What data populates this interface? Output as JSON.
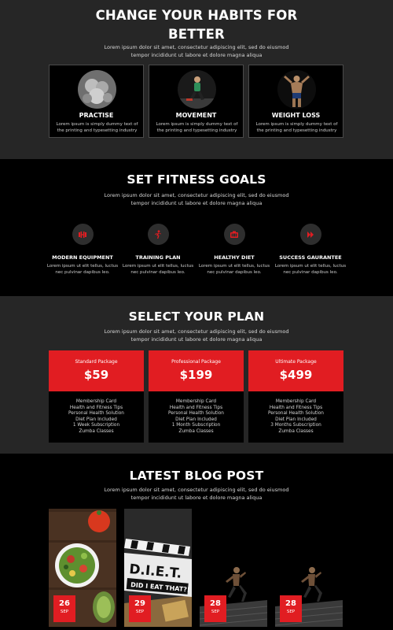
{
  "habits": {
    "title": "CHANGE YOUR HABITS FOR BETTER",
    "subtitle": "Lorem ipsum dolor sit amet, consectetur adipiscing elit, sed do eiusmod tempor incididunt ut labore et dolore magna aliqua",
    "cards": [
      {
        "title": "PRACTISE",
        "text": "Lorem ipsum is simply dummy text of the printing and typesetting industry"
      },
      {
        "title": "MOVEMENT",
        "text": "Lorem ipsum is simply dummy text of the printing and typesetting industry"
      },
      {
        "title": "WEIGHT LOSS",
        "text": "Lorem ipsum is simply dummy text of the printing and typesetting industry"
      }
    ]
  },
  "goals": {
    "title": "SET FITNESS GOALS",
    "subtitle": "Lorem ipsum dolor sit amet, consectetur adipiscing elit, sed do eiusmod tempor incididunt ut labore et dolore magna aliqua",
    "items": [
      {
        "title": "MODERN EQUIPMENT",
        "text": "Lorem ipsum ut elit tellus, luctus nec pulvinar dapibus leo.",
        "icon": "equipment-icon"
      },
      {
        "title": "TRAINING PLAN",
        "text": "Lorem ipsum ut elit tellus, luctus nec pulvinar dapibus leo.",
        "icon": "training-icon"
      },
      {
        "title": "HEALTHY DIET",
        "text": "Lorem ipsum ut elit tellus, luctus nec pulvinar dapibus leo.",
        "icon": "diet-icon"
      },
      {
        "title": "SUCCESS GAURANTEE",
        "text": "Lorem ipsum ut elit tellus, luctus nec pulvinar dapibus leo.",
        "icon": "success-icon"
      }
    ]
  },
  "plans": {
    "title": "SELECT YOUR PLAN",
    "subtitle": "Lorem ipsum dolor sit amet, consectetur adipiscing elit, sed do eiusmod tempor incididunt ut labore et dolore magna aliqua",
    "cards": [
      {
        "name": "Standard Package",
        "price": "$59",
        "features": [
          "Membership Card",
          "Health and Fitness Tips",
          "Personal Health Solution",
          "Diet Plan Included",
          "1 Week Subscription",
          "Zumba Classes"
        ]
      },
      {
        "name": "Professional Package",
        "price": "$199",
        "features": [
          "Membership Card",
          "Health and Fitness Tips",
          "Personal Health Solution",
          "Diet Plan Included",
          "1 Month Subscription",
          "Zumba Classes"
        ]
      },
      {
        "name": "Ultimate Package",
        "price": "$499",
        "features": [
          "Membership Card",
          "Health and Fitness Tips",
          "Personal Health Solution",
          "Diet Plan Included",
          "3 Months Subscription",
          "Zumba Classes"
        ]
      }
    ]
  },
  "blog": {
    "title": "LATEST BLOG POST",
    "subtitle": "Lorem ipsum dolor sit amet, consectetur adipiscing elit, sed do eiusmod tempor incididunt ut labore et dolore magna aliqua",
    "posts": [
      {
        "day": "26",
        "month": "SEP"
      },
      {
        "day": "29",
        "month": "SEP",
        "sign_line1": "D.I.E.T.",
        "sign_line2": "DID I EAT THAT?!"
      },
      {
        "day": "28",
        "month": "SEP"
      },
      {
        "day": "28",
        "month": "SEP"
      }
    ]
  },
  "colors": {
    "accent": "#e11d22",
    "dark_bg": "#262626",
    "black_bg": "#000000"
  }
}
